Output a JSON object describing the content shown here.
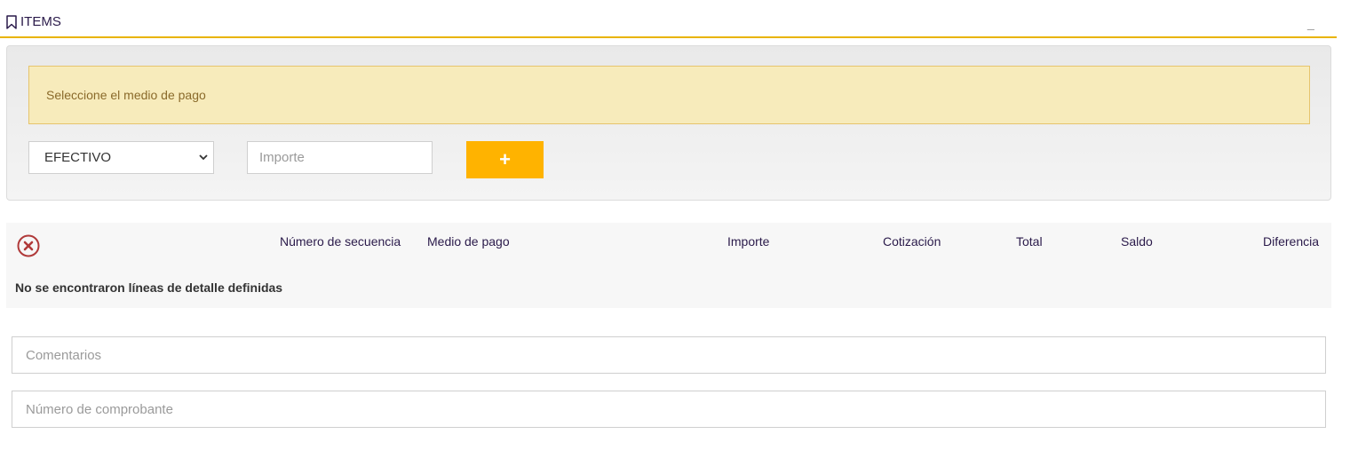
{
  "panel": {
    "title": "ITEMS",
    "minimize_label": "_"
  },
  "alert": {
    "text": "Seleccione el medio de pago"
  },
  "payment_form": {
    "method_selected": "EFECTIVO",
    "amount_placeholder": "Importe",
    "add_label": "+"
  },
  "table": {
    "headers": [
      "Número de secuencia",
      "Medio de pago",
      "Importe",
      "Cotización",
      "Total",
      "Saldo",
      "Diferencia"
    ],
    "empty_message": "No se encontraron líneas de detalle definidas"
  },
  "fields": {
    "comments_placeholder": "Comentarios",
    "voucher_placeholder": "Número de comprobante"
  },
  "colors": {
    "accent": "#ffb300",
    "header_rule": "#e9b400",
    "alert_bg": "#f7ebbb",
    "remove_icon": "#b03a3a"
  }
}
